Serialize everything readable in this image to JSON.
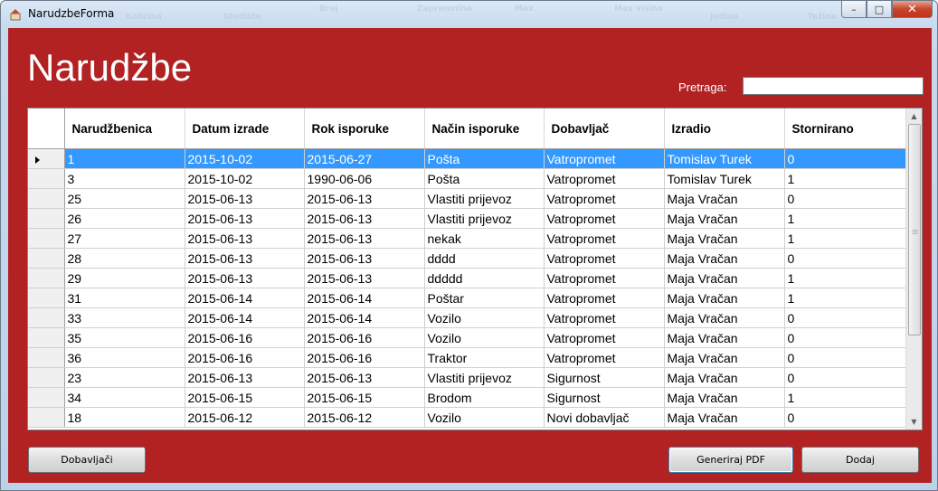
{
  "window": {
    "title": "NarudzbeForma"
  },
  "ghost_headers": [
    "Količina",
    "Gledište",
    "Broj",
    "Zapremnina",
    "Max",
    "Max visina",
    "Jedina",
    "Težina"
  ],
  "page": {
    "title": "Narudžbe"
  },
  "search": {
    "label": "Pretraga:",
    "value": ""
  },
  "table": {
    "columns": [
      "Narudžbenica",
      "Datum izrade",
      "Rok isporuke",
      "Način isporuke",
      "Dobavljač",
      "Izradio",
      "Stornirano"
    ],
    "rows": [
      [
        "1",
        "2015-10-02",
        "2015-06-27",
        "Pošta",
        "Vatropromet",
        "Tomislav Turek",
        "0"
      ],
      [
        "3",
        "2015-10-02",
        "1990-06-06",
        "Pošta",
        "Vatropromet",
        "Tomislav Turek",
        "1"
      ],
      [
        "25",
        "2015-06-13",
        "2015-06-13",
        "Vlastiti prijevoz",
        "Vatropromet",
        "Maja Vračan",
        "0"
      ],
      [
        "26",
        "2015-06-13",
        "2015-06-13",
        "Vlastiti prijevoz",
        "Vatropromet",
        "Maja Vračan",
        "1"
      ],
      [
        "27",
        "2015-06-13",
        "2015-06-13",
        "nekak",
        "Vatropromet",
        "Maja Vračan",
        "1"
      ],
      [
        "28",
        "2015-06-13",
        "2015-06-13",
        "dddd",
        "Vatropromet",
        "Maja Vračan",
        "0"
      ],
      [
        "29",
        "2015-06-13",
        "2015-06-13",
        "ddddd",
        "Vatropromet",
        "Maja Vračan",
        "1"
      ],
      [
        "31",
        "2015-06-14",
        "2015-06-14",
        "Poštar",
        "Vatropromet",
        "Maja Vračan",
        "1"
      ],
      [
        "33",
        "2015-06-14",
        "2015-06-14",
        "Vozilo",
        "Vatropromet",
        "Maja Vračan",
        "0"
      ],
      [
        "35",
        "2015-06-16",
        "2015-06-16",
        "Vozilo",
        "Vatropromet",
        "Maja Vračan",
        "0"
      ],
      [
        "36",
        "2015-06-16",
        "2015-06-16",
        "Traktor",
        "Vatropromet",
        "Maja Vračan",
        "0"
      ],
      [
        "23",
        "2015-06-13",
        "2015-06-13",
        "Vlastiti prijevoz",
        "Sigurnost",
        "Maja Vračan",
        "0"
      ],
      [
        "34",
        "2015-06-15",
        "2015-06-15",
        "Brodom",
        "Sigurnost",
        "Maja Vračan",
        "1"
      ],
      [
        "18",
        "2015-06-12",
        "2015-06-12",
        "Vozilo",
        "Novi dobavljač",
        "Maja Vračan",
        "0"
      ]
    ],
    "selected_row": 0
  },
  "buttons": {
    "suppliers": "Dobavljači",
    "generate_pdf": "Generiraj PDF",
    "add": "Dodaj"
  },
  "colors": {
    "background": "#b22222",
    "selection": "#3399ff"
  },
  "icons": {
    "app": "app-form-icon",
    "minimize": "minimize-icon",
    "maximize": "maximize-icon",
    "close": "close-icon",
    "current_row": "row-pointer-icon"
  }
}
